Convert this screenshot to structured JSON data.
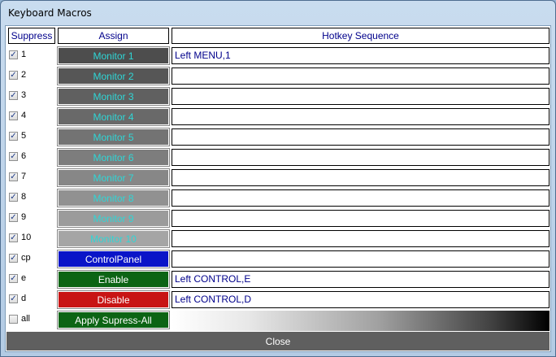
{
  "window": {
    "title": "Keyboard Macros"
  },
  "headers": {
    "suppress": "Suppress",
    "assign": "Assign",
    "hotkey": "Hotkey Sequence"
  },
  "rows": [
    {
      "key": "1",
      "checked": true,
      "assign": "Monitor 1",
      "bg": "#4d4d4d",
      "fg": "#2fd6d6",
      "hotkey": "Left MENU,1"
    },
    {
      "key": "2",
      "checked": true,
      "assign": "Monitor 2",
      "bg": "#565656",
      "fg": "#2fd6d6",
      "hotkey": ""
    },
    {
      "key": "3",
      "checked": true,
      "assign": "Monitor 3",
      "bg": "#606060",
      "fg": "#2fd6d6",
      "hotkey": ""
    },
    {
      "key": "4",
      "checked": true,
      "assign": "Monitor 4",
      "bg": "#696969",
      "fg": "#2fd6d6",
      "hotkey": ""
    },
    {
      "key": "5",
      "checked": true,
      "assign": "Monitor 5",
      "bg": "#737373",
      "fg": "#2fd6d6",
      "hotkey": ""
    },
    {
      "key": "6",
      "checked": true,
      "assign": "Monitor 6",
      "bg": "#7d7d7d",
      "fg": "#2fd6d6",
      "hotkey": ""
    },
    {
      "key": "7",
      "checked": true,
      "assign": "Monitor 7",
      "bg": "#878787",
      "fg": "#2fd6d6",
      "hotkey": ""
    },
    {
      "key": "8",
      "checked": true,
      "assign": "Monitor 8",
      "bg": "#919191",
      "fg": "#2fd6d6",
      "hotkey": ""
    },
    {
      "key": "9",
      "checked": true,
      "assign": "Monitor 9",
      "bg": "#9b9b9b",
      "fg": "#2fd6d6",
      "hotkey": ""
    },
    {
      "key": "10",
      "checked": true,
      "assign": "Monitor 10",
      "bg": "#a5a5a5",
      "fg": "#2fd6d6",
      "hotkey": ""
    },
    {
      "key": "cp",
      "checked": true,
      "assign": "ControlPanel",
      "bg": "#0a14c8",
      "fg": "#ffffff",
      "hotkey": ""
    },
    {
      "key": "e",
      "checked": true,
      "assign": "Enable",
      "bg": "#0c6414",
      "fg": "#ffffff",
      "hotkey": "Left CONTROL,E"
    },
    {
      "key": "d",
      "checked": true,
      "assign": "Disable",
      "bg": "#c81414",
      "fg": "#ffffff",
      "hotkey": "Left CONTROL,D"
    }
  ],
  "all_row": {
    "key": "all",
    "checked": false,
    "assign": "Apply Supress-All",
    "bg": "#0c6414",
    "fg": "#ffffff"
  },
  "close_label": "Close"
}
